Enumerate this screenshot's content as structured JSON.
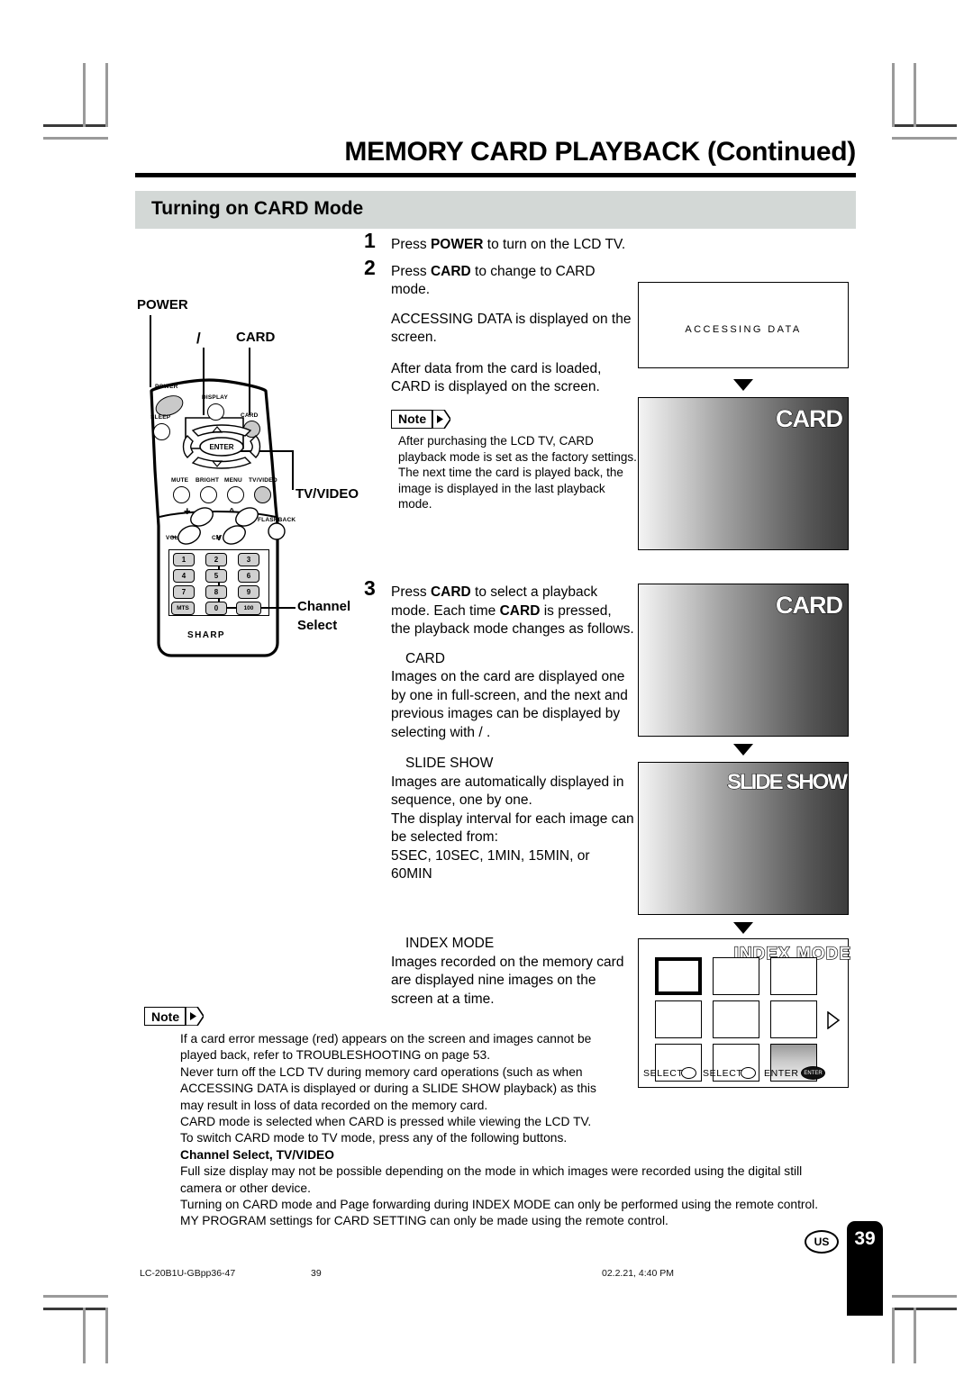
{
  "header": {
    "title": "MEMORY CARD PLAYBACK (Continued)",
    "section_title": "Turning on CARD Mode"
  },
  "steps": [
    {
      "number": "1",
      "text_parts": [
        {
          "t": "Press ",
          "b": false
        },
        {
          "t": "POWER",
          "b": true
        },
        {
          "t": " to turn on the LCD TV.",
          "b": false
        }
      ],
      "plain": "Press POWER to turn on the LCD TV."
    },
    {
      "number": "2",
      "plain": "Press CARD to change to CARD mode."
    },
    {
      "number": "3",
      "plain": "Press CARD to select a playback mode. Each time CARD is pressed, the playback mode changes as follows."
    }
  ],
  "step1": {
    "num": "1",
    "pre": "Press ",
    "bold": "POWER",
    "post": " to turn on the LCD TV."
  },
  "step2": {
    "num": "2",
    "pre": "Press ",
    "bold": "CARD",
    "post": " to change to CARD mode.",
    "para_accessing": "ACCESSING DATA is displayed on the screen.",
    "para_loaded": "After data from the card is loaded, CARD is displayed on the screen."
  },
  "step3": {
    "num": "3",
    "pre": "Press ",
    "bold1": "CARD",
    "mid": " to select a playback mode. Each time ",
    "bold2": "CARD",
    "post": " is pressed, the playback mode changes as follows."
  },
  "note_label": "Note",
  "note_step2": "After purchasing the LCD TV, CARD playback mode is set as the factory settings. The next time the card is played back, the image is displayed in the last playback mode.",
  "modes": [
    {
      "name": "CARD",
      "body": "Images on the card are displayed one by one in full-screen, and the next and previous images can be displayed by selecting with   /  ."
    },
    {
      "name": "SLIDE SHOW",
      "body": "Images are automatically displayed in sequence, one by one.",
      "body2": "The display interval for each image can be selected from:",
      "body3": "5SEC, 10SEC, 1MIN, 15MIN, or 60MIN"
    },
    {
      "name": "INDEX MODE",
      "body": "Images recorded on the memory card are displayed nine images on the screen at a time."
    }
  ],
  "bottom_note_lines": [
    "If a card error message (red) appears on the screen and images cannot be",
    "played back, refer to TROUBLESHOOTING on page 53.",
    "Never turn off the LCD TV during memory card operations (such as when",
    "ACCESSING DATA is displayed or during a SLIDE SHOW playback) as this",
    "may result in loss of data recorded on the memory card.",
    "CARD mode is selected when CARD is pressed while viewing the LCD TV.",
    "To switch CARD mode to TV mode, press any of the following buttons.",
    "Channel Select, TV/VIDEO",
    "Full size display may not be possible depending on the mode in which images were recorded using the digital still",
    "camera or other device.",
    "Turning on CARD mode and Page forwarding during INDEX MODE can only be performed using the remote control.",
    "MY PROGRAM settings for CARD SETTING can only be made using the remote control."
  ],
  "screens": {
    "accessing": {
      "text": "ACCESSING DATA"
    },
    "card1": {
      "osd": "CARD"
    },
    "card2": {
      "osd": "CARD"
    },
    "slideshow": {
      "osd": "SLIDE SHOW"
    },
    "index": {
      "osd": "INDEX MODE",
      "select_left": "SELECT",
      "select_mid": "SELECT",
      "enter": "ENTER",
      "enter_icon": "ENTER"
    }
  },
  "remote": {
    "callouts": {
      "power": "POWER",
      "updown": "/",
      "card": "CARD",
      "tvvideo": "TV/VIDEO",
      "channel_line1": "Channel",
      "channel_line2": "Select"
    },
    "buttons": {
      "power": "POWER",
      "sleep": "SLEEP",
      "display": "DISPLAY",
      "card": "CARD",
      "enter": "ENTER",
      "mute": "MUTE",
      "bright": "BRIGHT",
      "menu": "MENU",
      "tvvideo": "TV/VIDEO",
      "flashback": "FLASHBACK",
      "vol": "VOL",
      "ch": "CH",
      "brand": "SHARP"
    },
    "keypad": [
      "1",
      "2",
      "3",
      "4",
      "5",
      "6",
      "7",
      "8",
      "9",
      "MTS",
      "0",
      "100"
    ]
  },
  "footer": {
    "file": "LC-20B1U-GBpp36-47",
    "page_center": "39",
    "timestamp": "02.2.21, 4:40 PM",
    "region": "US",
    "page_number": "39"
  }
}
